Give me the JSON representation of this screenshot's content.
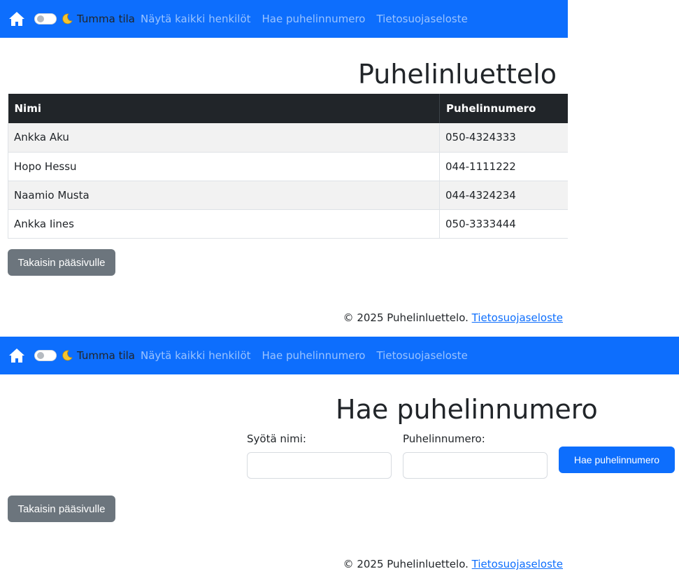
{
  "colors": {
    "primary": "#0d6efd",
    "secondary": "#6c757d",
    "table_header": "#212529"
  },
  "navbar": {
    "home_icon": "home-icon",
    "dark_mode_icon": "moon-icon",
    "dark_mode_label": "Tumma tila",
    "links": [
      "Näytä kaikki henkilöt",
      "Hae puhelinnumero",
      "Tietosuojaseloste"
    ]
  },
  "list_page": {
    "title": "Puhelinluettelo",
    "columns": [
      "Nimi",
      "Puhelinnumero"
    ],
    "rows": [
      [
        "Ankka Aku",
        "050-4324333"
      ],
      [
        "Hopo Hessu",
        "044-1111222"
      ],
      [
        "Naamio Musta",
        "044-4324234"
      ],
      [
        "Ankka Iines",
        "050-3333444"
      ]
    ],
    "back_button": "Takaisin pääsivulle"
  },
  "search_page": {
    "title": "Hae puhelinnumero",
    "name_label": "Syötä nimi:",
    "name_value": "",
    "phone_label": "Puhelinnumero:",
    "phone_value": "",
    "search_button": "Hae puhelinnumero",
    "back_button": "Takaisin pääsivulle"
  },
  "footer": {
    "text": "© 2025 Puhelinluettelo.",
    "link": "Tietosuojaseloste"
  }
}
